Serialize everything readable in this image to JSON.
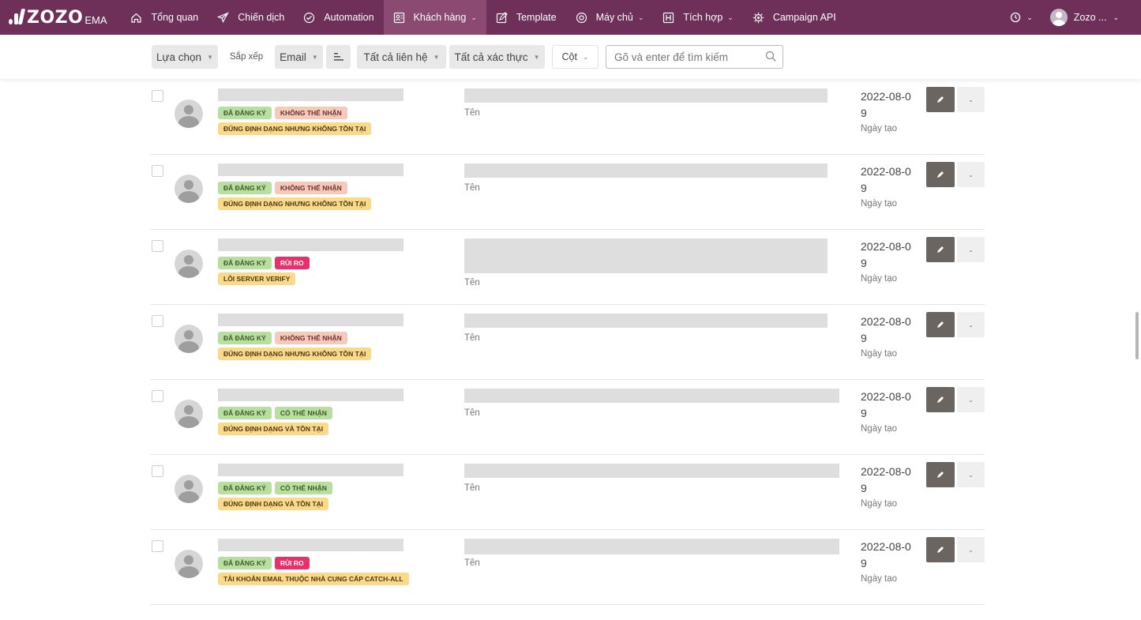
{
  "brand": {
    "name": "ZOZO",
    "suffix": "EMA"
  },
  "nav": [
    {
      "label": "Tổng quan",
      "icon": "home-icon",
      "caret": false,
      "active": false
    },
    {
      "label": "Chiến dịch",
      "icon": "paper-plane-icon",
      "caret": false,
      "active": false
    },
    {
      "label": "Automation",
      "icon": "automation-icon",
      "caret": false,
      "active": false
    },
    {
      "label": "Khách hàng",
      "icon": "contacts-icon",
      "caret": true,
      "active": true
    },
    {
      "label": "Template",
      "icon": "template-edit-icon",
      "caret": false,
      "active": false
    },
    {
      "label": "Máy chủ",
      "icon": "server-icon",
      "caret": true,
      "active": false
    },
    {
      "label": "Tích hợp",
      "icon": "integration-icon",
      "caret": true,
      "active": false
    },
    {
      "label": "Campaign API",
      "icon": "api-gear-icon",
      "caret": false,
      "active": false
    }
  ],
  "user": {
    "name": "Zozo ..."
  },
  "toolbar": {
    "selection": "Lựa chọn",
    "sort_label": "Sắp xếp",
    "sort_field": "Email",
    "contacts_filter": "Tất cả liên hệ",
    "verify_filter": "Tất cả xác thực",
    "columns": "Cột",
    "search_placeholder": "Gõ và enter để tìm kiếm"
  },
  "labels": {
    "name_field": "Tên",
    "date_field": "Ngày tạo"
  },
  "rows": [
    {
      "tags": [
        [
          "Đã đăng ký",
          "green"
        ],
        [
          "Không thể nhận",
          "pink"
        ]
      ],
      "status": "Đúng định dạng nhưng không tồn tại",
      "date": "2022-08-09"
    },
    {
      "tags": [
        [
          "Đã đăng ký",
          "green"
        ],
        [
          "Không thể nhận",
          "pink"
        ]
      ],
      "status": "Đúng định dạng nhưng không tồn tại",
      "date": "2022-08-09"
    },
    {
      "tags": [
        [
          "Đã đăng ký",
          "green"
        ],
        [
          "Rủi ro",
          "red"
        ]
      ],
      "status": "Lỗi server verify",
      "date": "2022-08-09"
    },
    {
      "tags": [
        [
          "Đã đăng ký",
          "green"
        ],
        [
          "Không thể nhận",
          "pink"
        ]
      ],
      "status": "Đúng định dạng nhưng không tồn tại",
      "date": "2022-08-09"
    },
    {
      "tags": [
        [
          "Đã đăng ký",
          "green"
        ],
        [
          "Có thể nhận",
          "green"
        ]
      ],
      "status": "Đúng định dạng và tồn tại",
      "date": "2022-08-09"
    },
    {
      "tags": [
        [
          "Đã đăng ký",
          "green"
        ],
        [
          "Có thể nhận",
          "green"
        ]
      ],
      "status": "Đúng định dạng và tồn tại",
      "date": "2022-08-09"
    },
    {
      "tags": [
        [
          "Đã đăng ký",
          "green"
        ],
        [
          "Rủi ro",
          "red"
        ]
      ],
      "status": "Tài khoản email thuộc nhà cung cấp catch-all",
      "date": "2022-08-09"
    }
  ],
  "colors": {
    "topbar": "#6e2f58",
    "active_nav": "#8a4a72",
    "edit_button": "#6a6560"
  }
}
